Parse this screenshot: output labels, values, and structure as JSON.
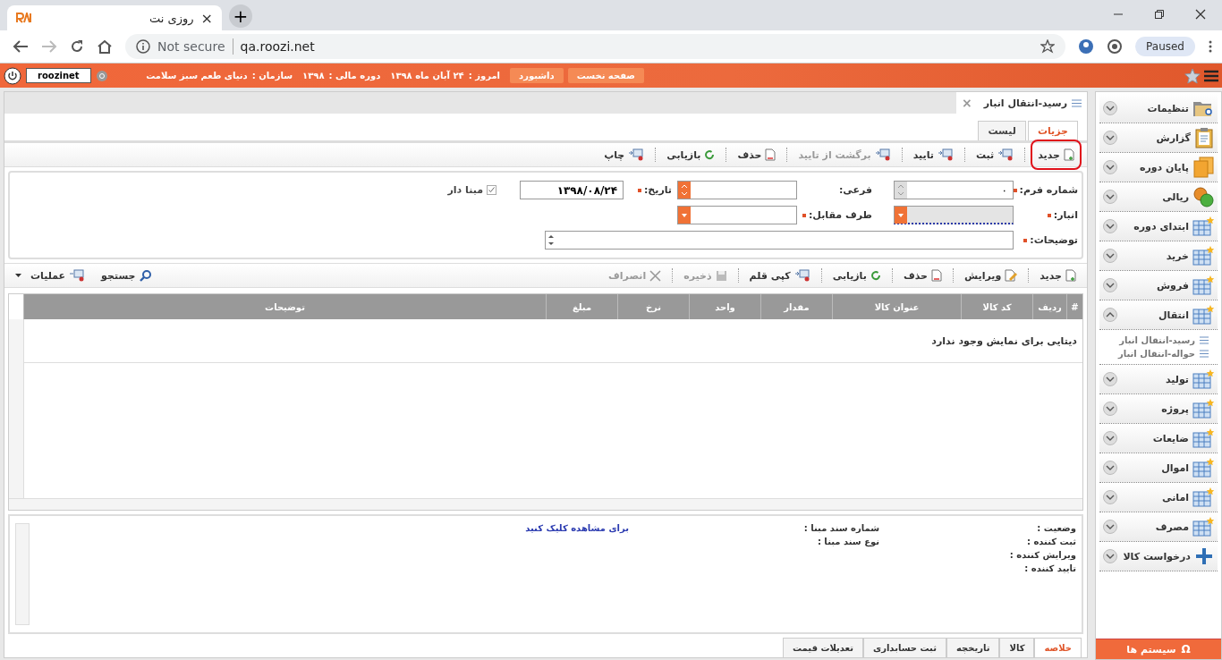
{
  "browser": {
    "tab_title": "روزی نت",
    "tab_close": "×",
    "new_tab": "+",
    "security": "Not secure",
    "url": "qa.roozi.net",
    "profile": "Paused"
  },
  "header": {
    "user": "roozinet",
    "info": [
      {
        "label": "امروز :",
        "value": "۲۴ آبان ماه ۱۳۹۸"
      },
      {
        "label": "دوره مالی :",
        "value": "۱۳۹۸"
      },
      {
        "label": "سازمان :",
        "value": "دنیای طعم سبز سلامت"
      }
    ],
    "buttons": [
      "صفحه نخست",
      "داشبورد"
    ]
  },
  "document": {
    "title": "رسید-انتقال انبار",
    "close": "×"
  },
  "tabs": [
    {
      "label": "جزیات",
      "selected": true
    },
    {
      "label": "لیست",
      "selected": false
    }
  ],
  "toolbar": [
    {
      "label": "جدید",
      "disabled": false,
      "highlighted": true
    },
    {
      "label": "ثبت",
      "disabled": false,
      "highlighted": false
    },
    {
      "label": "تایید",
      "disabled": false,
      "highlighted": false
    },
    {
      "label": "برگشت از تایید",
      "disabled": true,
      "highlighted": false
    },
    {
      "label": "حذف",
      "disabled": false,
      "highlighted": false
    },
    {
      "label": "بازیابی",
      "disabled": false,
      "highlighted": false
    },
    {
      "label": "چاپ",
      "disabled": false,
      "highlighted": false
    }
  ],
  "form": {
    "form_number": {
      "label": "شماره فرم:",
      "required": true,
      "value": "۰"
    },
    "sub": {
      "label": "فرعی:"
    },
    "date": {
      "label": "تاریخ:",
      "required": true,
      "value": "۱۳۹۸/۰۸/۲۴"
    },
    "based": {
      "label": "مبنا دار",
      "checked": true
    },
    "warehouse": {
      "label": "انبار:",
      "required": true
    },
    "counterparty": {
      "label": "طرف مقابل:",
      "required": true
    },
    "description": {
      "label": "توضیحات:",
      "required": true
    }
  },
  "grid_toolbar": [
    {
      "label": "جدید",
      "disabled": false
    },
    {
      "label": "ویرایش",
      "disabled": false
    },
    {
      "label": "حذف",
      "disabled": false
    },
    {
      "label": "بازیابی",
      "disabled": false
    },
    {
      "label": "کپی قلم",
      "disabled": false
    },
    {
      "label": "ذخیره",
      "disabled": true
    },
    {
      "label": "انصراف",
      "disabled": true
    }
  ],
  "grid_tools": [
    "جستجو",
    "عملیات"
  ],
  "table": {
    "columns": [
      "#",
      "ردیف",
      "کد کالا",
      "عنوان کالا",
      "مقدار",
      "واحد",
      "نرخ",
      "مبلغ",
      "توضیحات"
    ],
    "empty_message": "دیتایی برای نمایش وجود ندارد"
  },
  "summary": {
    "labels": [
      "وضعیت :",
      "ثبت کننده :",
      "ویرایش کننده :",
      "تایید کننده :"
    ],
    "base_labels": [
      "شماره سند مبنا :",
      "نوع سند مبنا :"
    ],
    "link": "برای مشاهده کلیک کنید"
  },
  "bottom_tabs": [
    {
      "label": "خلاصه",
      "selected": true
    },
    {
      "label": "کالا",
      "selected": false
    },
    {
      "label": "تاریخچه",
      "selected": false
    },
    {
      "label": "ثبت حسابداری",
      "selected": false
    },
    {
      "label": "تعدیلات قیمت",
      "selected": false
    }
  ],
  "sidebar": {
    "items": [
      {
        "label": "تنظیمات",
        "expanded": false
      },
      {
        "label": "گزارش",
        "expanded": false
      },
      {
        "label": "پایان دوره",
        "expanded": false
      },
      {
        "label": "ریالی",
        "expanded": false
      },
      {
        "label": "ابتدای دوره",
        "expanded": false
      },
      {
        "label": "خرید",
        "expanded": false
      },
      {
        "label": "فروش",
        "expanded": false
      },
      {
        "label": "انتقال",
        "expanded": true,
        "children": [
          {
            "label": "رسید-انتقال انبار"
          },
          {
            "label": "حواله-انتقال انبار"
          }
        ]
      },
      {
        "label": "تولید",
        "expanded": false
      },
      {
        "label": "پروژه",
        "expanded": false
      },
      {
        "label": "ضایعات",
        "expanded": false
      },
      {
        "label": "اموال",
        "expanded": false
      },
      {
        "label": "امانی",
        "expanded": false
      },
      {
        "label": "مصرف",
        "expanded": false
      },
      {
        "label": "درخواست کالا",
        "expanded": false
      }
    ],
    "footer_glyph": "Ω",
    "footer": "سیستم ها"
  }
}
